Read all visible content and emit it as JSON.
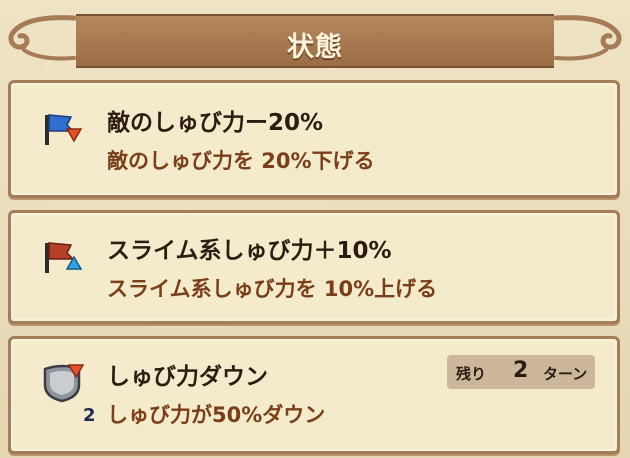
{
  "header": {
    "title": "状態"
  },
  "effects": [
    {
      "title": "敵のしゅび力ー20%",
      "description": "敵のしゅび力を 20%下げる",
      "icon": "blue-flag-down-arrow-icon"
    },
    {
      "title": "スライム系しゅび力＋10%",
      "description": "スライム系しゅび力を 10%上げる",
      "icon": "red-flag-up-arrow-icon"
    },
    {
      "title": "しゅび力ダウン",
      "description": "しゅび力が50%ダウン",
      "icon": "shield-down-arrow-icon",
      "stack": "2",
      "remaining": {
        "label_pre": "残り",
        "value": "2",
        "label_post": "ターン"
      }
    }
  ],
  "colors": {
    "title": "#2b1d12",
    "description": "#7a3f18",
    "header": "#a67b52",
    "panel": "#f4ebcd",
    "up_arrow": "#2ea3e6",
    "down_arrow": "#e8502a"
  }
}
